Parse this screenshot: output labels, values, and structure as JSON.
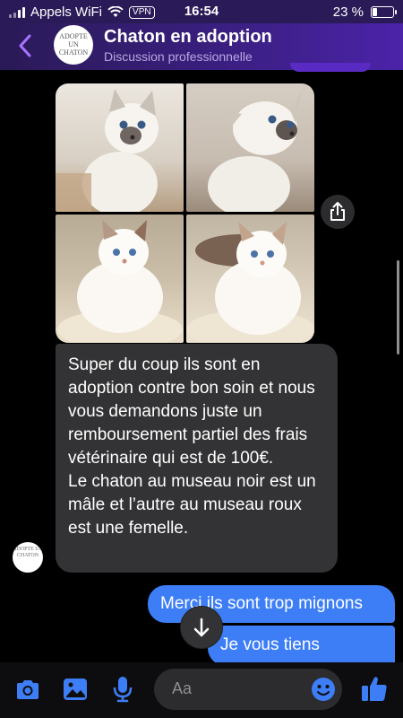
{
  "status_bar": {
    "carrier": "Appels WiFi",
    "vpn": "VPN",
    "time": "16:54",
    "battery": "23 %",
    "battery_level": 0.23
  },
  "header": {
    "title": "Chaton en adoption",
    "subtitle": "Discussion professionnelle",
    "avatar_text": "ADOPTE UN CHATON",
    "back_icon": "chevron-left-icon"
  },
  "photos": {
    "count": 4,
    "share_icon": "share-icon"
  },
  "messages": [
    {
      "direction": "incoming",
      "text": "Super du coup ils sont en adoption contre bon soin et nous vous demandons juste un remboursement partiel des frais vétérinaire qui est de 100€.\nLe chaton au museau noir est un mâle et l’autre au museau roux est une femelle.",
      "avatar_text": "ADOPTE UN CHATON"
    },
    {
      "direction": "outgoing",
      "text": "Merci ils sont trop mignons"
    },
    {
      "direction": "outgoing",
      "text": "Je vous tiens"
    }
  ],
  "composer": {
    "placeholder": "Aa",
    "icons": [
      "camera-icon",
      "gallery-icon",
      "microphone-icon",
      "emoji-icon",
      "thumbs-up-icon"
    ]
  },
  "colors": {
    "accent_purple": "#a774ff",
    "bubble_outgoing": "#3d7ef6",
    "bubble_incoming": "#333335",
    "composer_icon_blue": "#3d7ef6"
  }
}
